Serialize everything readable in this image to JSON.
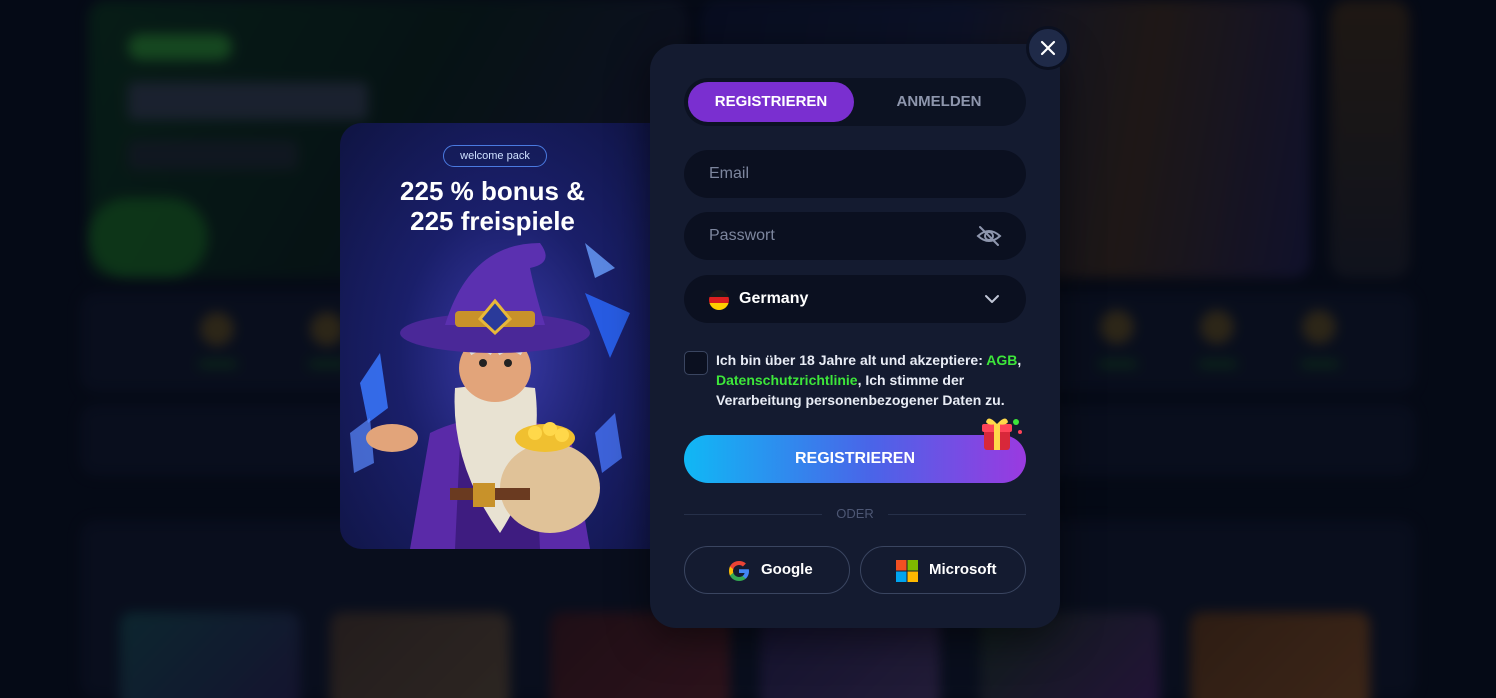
{
  "background": {
    "blurred": true
  },
  "promo": {
    "badge": "welcome pack",
    "headline_line1": "225 % bonus &",
    "headline_line2": "225 freispiele",
    "illustration": "wizard-with-gold-bag"
  },
  "modal": {
    "tabs": [
      {
        "label": "REGISTRIEREN",
        "active": true
      },
      {
        "label": "ANMELDEN",
        "active": false
      }
    ],
    "email": {
      "placeholder": "Email",
      "value": ""
    },
    "password": {
      "placeholder": "Passwort",
      "value": "",
      "toggle_icon": "eye-off-icon"
    },
    "country": {
      "value": "Germany",
      "flag": "flag-de-icon"
    },
    "consent": {
      "checked": false,
      "text_before": "Ich bin über 18 Jahre alt und akzeptiere: ",
      "link1": "AGB",
      "separator": ",",
      "link2": "Datenschutzrichtlinie",
      "text_after": ", Ich stimme der Verarbeitung personenbezogener Daten zu."
    },
    "submit_label": "REGISTRIEREN",
    "divider_label": "ODER",
    "social": [
      {
        "label": "Google",
        "icon": "google-icon"
      },
      {
        "label": "Microsoft",
        "icon": "microsoft-icon"
      }
    ]
  },
  "colors": {
    "accent_purple": "#7a2fd0",
    "link_green": "#3de63a",
    "modal_bg": "#141b30",
    "button_gradient_start": "#10b8f5",
    "button_gradient_end": "#9a3ae0"
  }
}
